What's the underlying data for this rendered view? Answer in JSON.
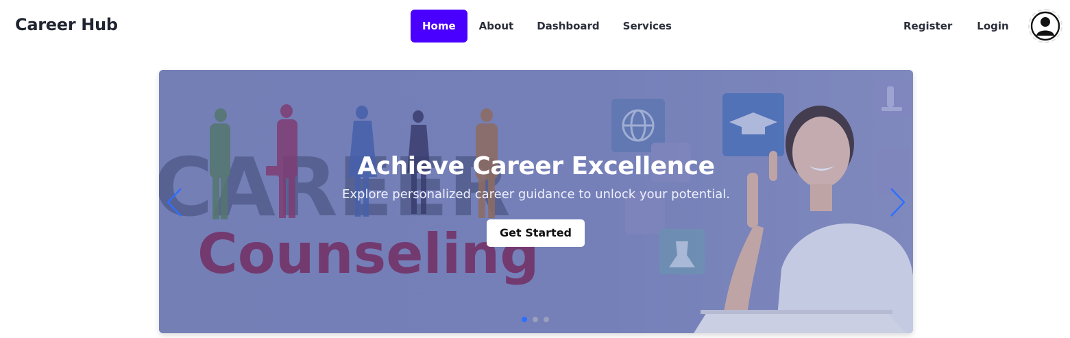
{
  "brand": {
    "name": "Career Hub"
  },
  "nav": {
    "links": [
      {
        "label": "Home"
      },
      {
        "label": "About"
      },
      {
        "label": "Dashboard"
      },
      {
        "label": "Services"
      }
    ],
    "active_index": 0,
    "auth": {
      "register_label": "Register",
      "login_label": "Login"
    },
    "avatar_icon": "user-avatar-icon"
  },
  "carousel": {
    "slide": {
      "title": "Achieve Career Excellence",
      "text": "Explore personalized career guidance to unlock your potential.",
      "button_label": "Get Started",
      "image_text": {
        "line1": "CAREER",
        "line2": "Counseling"
      }
    },
    "slide_count": 3,
    "active_slide": 0,
    "prev_icon": "chevron-left-icon",
    "next_icon": "chevron-right-icon"
  },
  "colors": {
    "accent": "#4a00ff",
    "text": "#2b2f3a",
    "carousel_arrow": "#2d6fff",
    "overlay": "#6070b2"
  }
}
